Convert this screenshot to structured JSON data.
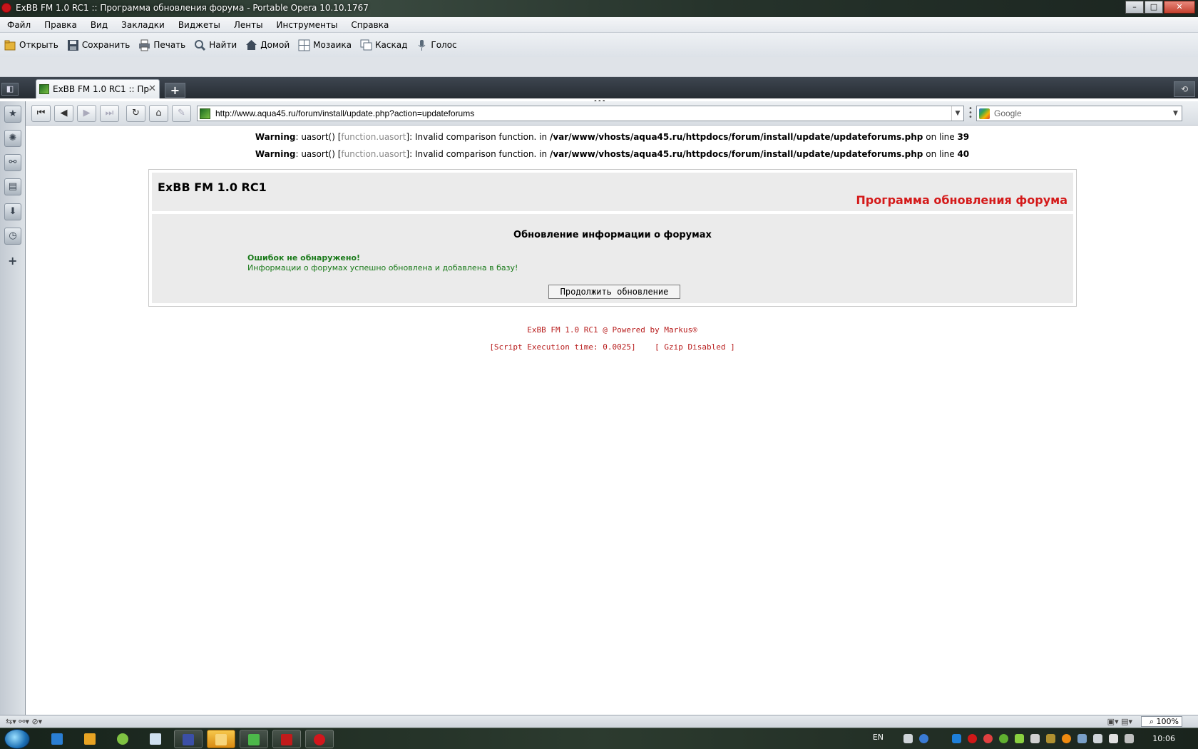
{
  "window": {
    "title": "ExBB FM 1.0 RC1 :: Программа обновления форума - Portable Opera 10.10.1767",
    "buttons": {
      "minimize": "–",
      "maximize": "□",
      "close": "✕"
    }
  },
  "menu": [
    "Файл",
    "Правка",
    "Вид",
    "Закладки",
    "Виджеты",
    "Ленты",
    "Инструменты",
    "Справка"
  ],
  "toolbar": [
    {
      "label": "Открыть",
      "icon": "folder-icon",
      "color": "#e5b43a"
    },
    {
      "label": "Сохранить",
      "icon": "save-icon",
      "color": "#3d4a5a"
    },
    {
      "label": "Печать",
      "icon": "print-icon",
      "color": "#6b7480"
    },
    {
      "label": "Найти",
      "icon": "search-icon",
      "color": "#4a5a6a"
    },
    {
      "label": "Домой",
      "icon": "home-icon",
      "color": "#3d4a5a"
    },
    {
      "label": "Мозаика",
      "icon": "tile-icon",
      "color": "#5a6a7a"
    },
    {
      "label": "Каскад",
      "icon": "cascade-icon",
      "color": "#5a6a7a"
    },
    {
      "label": "Голос",
      "icon": "microphone-icon",
      "color": "#5a6a7a"
    }
  ],
  "tabs": {
    "active_title": "ExBB FM 1.0 RC1 :: Про...",
    "close": "✕",
    "new_tab": "+"
  },
  "address": {
    "url": "http://www.aqua45.ru/forum/install/update.php?action=updateforums",
    "search_placeholder": "Google"
  },
  "nav_buttons": [
    {
      "name": "rewind-button",
      "glyph": "⏮"
    },
    {
      "name": "back-button",
      "glyph": "◀"
    },
    {
      "name": "forward-button",
      "glyph": "▶"
    },
    {
      "name": "fast-forward-button",
      "glyph": "⏭"
    },
    {
      "name": "reload-button",
      "glyph": "↻"
    },
    {
      "name": "home-button",
      "glyph": "⌂"
    },
    {
      "name": "wand-button",
      "glyph": "✎"
    }
  ],
  "side_panel": [
    "bookmarks-icon",
    "widgets-icon",
    "links-icon",
    "notes-icon",
    "downloads-icon",
    "history-icon"
  ],
  "page": {
    "warnings": [
      {
        "label": "Warning",
        "pre": ": uasort() [",
        "link": "function.uasort",
        "post": "]: Invalid comparison function. in ",
        "path": "/var/www/vhosts/aqua45.ru/httpdocs/forum/install/update/updateforums.php",
        "online": " on line ",
        "line": "39"
      },
      {
        "label": "Warning",
        "pre": ": uasort() [",
        "link": "function.uasort",
        "post": "]: Invalid comparison function. in ",
        "path": "/var/www/vhosts/aqua45.ru/httpdocs/forum/install/update/updateforums.php",
        "online": " on line ",
        "line": "40"
      }
    ],
    "forum_name": "ExBB FM 1.0 RC1",
    "program_title": "Программа обновления форума",
    "section_title": "Обновление информации о форумах",
    "ok_message": "Ошибок не обнаружено!",
    "ok_detail": "Информации о форумах успешно обновлена и добавлена в базу!",
    "continue_button": "Продолжить обновление",
    "footer_powered": "ExBB FM 1.0 RC1 @ Powered by Markus®",
    "footer_exec": "[Script Execution time: 0.0025]    [ Gzip Disabled ]"
  },
  "status": {
    "zoom": "100%"
  },
  "taskbar": {
    "lang": "EN",
    "clock": "10:06"
  }
}
